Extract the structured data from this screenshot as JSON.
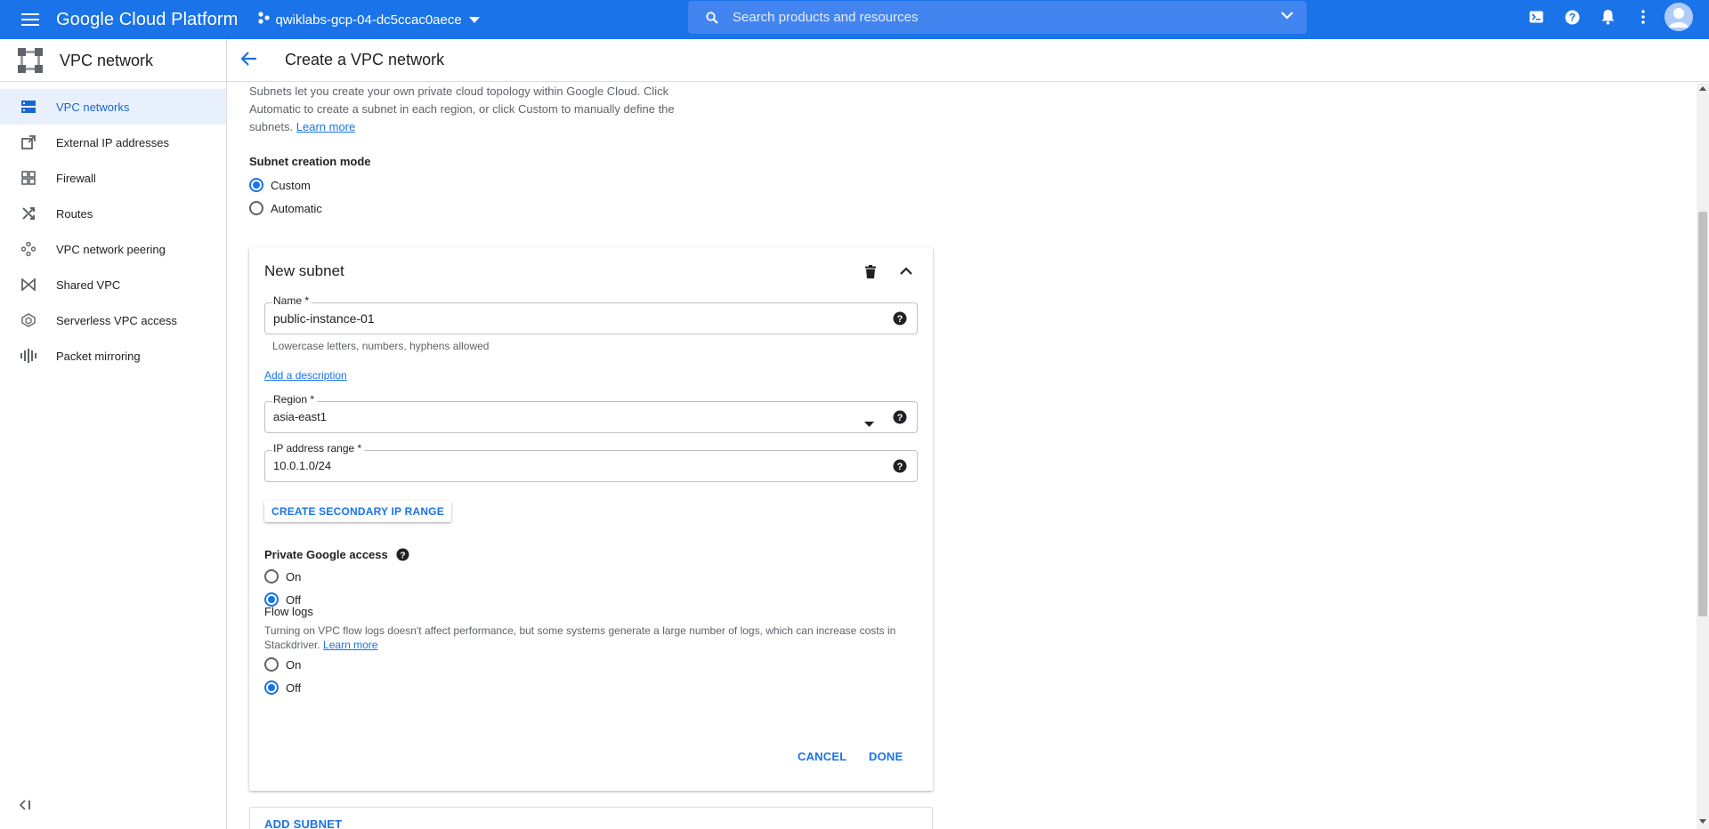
{
  "topbar": {
    "brand": "Google Cloud Platform",
    "project": "qwiklabs-gcp-04-dc5ccac0aece",
    "search_placeholder": "Search products and resources"
  },
  "product": {
    "title": "VPC network"
  },
  "page": {
    "title": "Create a VPC network"
  },
  "sidebar": {
    "items": [
      {
        "label": "VPC networks",
        "icon": "vpc-networks-icon",
        "active": true
      },
      {
        "label": "External IP addresses",
        "icon": "external-ip-icon",
        "active": false
      },
      {
        "label": "Firewall",
        "icon": "firewall-icon",
        "active": false
      },
      {
        "label": "Routes",
        "icon": "routes-icon",
        "active": false
      },
      {
        "label": "VPC network peering",
        "icon": "peering-icon",
        "active": false
      },
      {
        "label": "Shared VPC",
        "icon": "shared-vpc-icon",
        "active": false
      },
      {
        "label": "Serverless VPC access",
        "icon": "serverless-icon",
        "active": false
      },
      {
        "label": "Packet mirroring",
        "icon": "packet-mirroring-icon",
        "active": false
      }
    ]
  },
  "intro": {
    "text": "Subnets let you create your own private cloud topology within Google Cloud. Click Automatic to create a subnet in each region, or click Custom to manually define the subnets.",
    "learn_more": "Learn more"
  },
  "subnet_mode": {
    "label": "Subnet creation mode",
    "options": [
      {
        "label": "Custom",
        "checked": true
      },
      {
        "label": "Automatic",
        "checked": false
      }
    ]
  },
  "subnet": {
    "title": "New subnet",
    "name": {
      "label": "Name *",
      "value": "public-instance-01",
      "hint": "Lowercase letters, numbers, hyphens allowed"
    },
    "add_description": "Add a description",
    "region": {
      "label": "Region *",
      "value": "asia-east1"
    },
    "ip_range": {
      "label": "IP address range *",
      "value": "10.0.1.0/24"
    },
    "secondary_button": "CREATE SECONDARY IP RANGE",
    "private_access": {
      "label": "Private Google access",
      "options": [
        {
          "label": "On",
          "checked": false
        },
        {
          "label": "Off",
          "checked": true
        }
      ]
    },
    "flow_logs": {
      "label": "Flow logs",
      "description": "Turning on VPC flow logs doesn't affect performance, but some systems generate a large number of logs, which can increase costs in Stackdriver.",
      "learn_more": "Learn more",
      "options": [
        {
          "label": "On",
          "checked": false
        },
        {
          "label": "Off",
          "checked": true
        }
      ]
    },
    "cancel": "CANCEL",
    "done": "DONE"
  },
  "add_subnet": "ADD SUBNET",
  "colors": {
    "primary": "#1a73e8",
    "active_nav_bg": "#e8f0fe"
  }
}
